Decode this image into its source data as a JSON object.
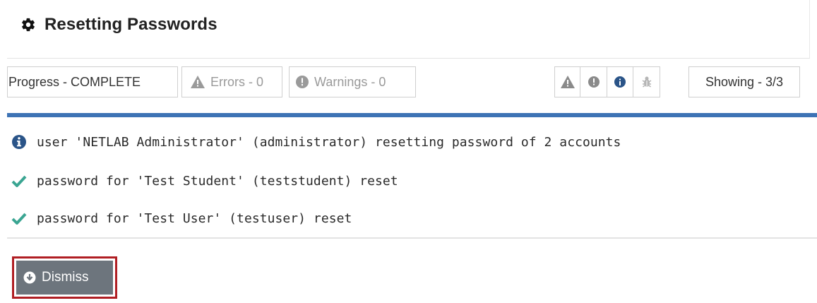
{
  "header": {
    "title": "Resetting Passwords",
    "icon": "gear-icon"
  },
  "toolbar": {
    "progress_label": "Progress - COMPLETE",
    "errors_label": "Errors - 0",
    "warnings_label": "Warnings - 0",
    "filters": [
      "warning-filter-icon",
      "error-filter-icon",
      "info-filter-icon",
      "debug-filter-icon"
    ],
    "showing_label": "Showing - 3/3"
  },
  "colors": {
    "accent": "#3d73b5",
    "success": "#3aa592",
    "info": "#2a5488",
    "dismiss_bg": "#6d757d",
    "highlight": "#b01e23"
  },
  "log": {
    "lines": [
      {
        "icon": "info-icon",
        "text": "user 'NETLAB Administrator' (administrator) resetting password of 2 accounts"
      },
      {
        "icon": "check-icon",
        "text": "password for 'Test Student' (teststudent) reset"
      },
      {
        "icon": "check-icon",
        "text": "password for 'Test User' (testuser) reset"
      }
    ]
  },
  "actions": {
    "dismiss_label": "Dismiss"
  }
}
